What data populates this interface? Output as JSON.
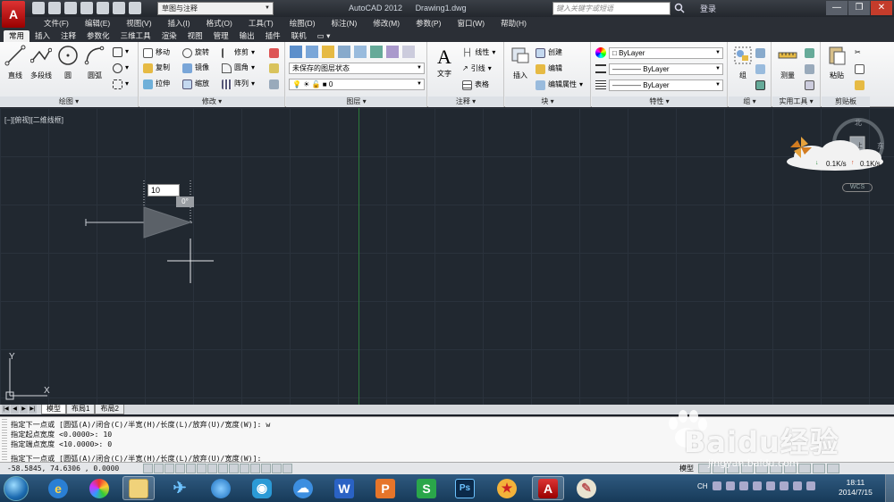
{
  "titlebar": {
    "logo": "A",
    "workspace": "草图与注释",
    "app_name": "AutoCAD 2012",
    "document": "Drawing1.dwg",
    "search_placeholder": "键入关键字或短语",
    "login": "登录",
    "minimize": "—",
    "restore": "❐",
    "close": "✕"
  },
  "menu": [
    "文件(F)",
    "编辑(E)",
    "视图(V)",
    "插入(I)",
    "格式(O)",
    "工具(T)",
    "绘图(D)",
    "标注(N)",
    "修改(M)",
    "参数(P)",
    "窗口(W)",
    "帮助(H)"
  ],
  "ribbon_tabs": [
    "常用",
    "插入",
    "注释",
    "参数化",
    "三维工具",
    "渲染",
    "视图",
    "管理",
    "输出",
    "插件",
    "联机"
  ],
  "panels": {
    "draw": {
      "title": "绘图 ▾",
      "line": "直线",
      "polyline": "多段线",
      "circle": "圆",
      "arc": "圆弧"
    },
    "modify": {
      "title": "修改 ▾",
      "move": "移动",
      "rotate": "旋转",
      "trim": "修剪",
      "copy": "复制",
      "mirror": "镜像",
      "fillet": "圆角",
      "stretch": "拉伸",
      "scale": "缩放",
      "array": "阵列"
    },
    "layers": {
      "title": "图层 ▾",
      "layer_state": "未保存的图层状态",
      "layer_value": "0"
    },
    "annotation": {
      "title": "注释 ▾",
      "text": "文字",
      "linear": "线性",
      "leader": "引线",
      "table": "表格"
    },
    "block": {
      "title": "块 ▾",
      "insert": "插入",
      "create": "创建",
      "edit": "编辑",
      "edit_attr": "编辑属性"
    },
    "properties": {
      "title": "特性 ▾",
      "color": "ByLayer",
      "linetype": "ByLayer",
      "lineweight": "ByLayer"
    },
    "groups": {
      "title": "组 ▾",
      "group": "组"
    },
    "utilities": {
      "title": "实用工具 ▾",
      "measure": "测量"
    },
    "clipboard": {
      "title": "剪贴板",
      "paste": "粘贴"
    }
  },
  "canvas": {
    "viewport_label": "[−][俯视][二维线框]",
    "dynamic_input_value": "10",
    "angle_tooltip": "0°",
    "viewcube": {
      "north": "北",
      "west": "西",
      "east": "东",
      "top": "上"
    },
    "wcs": "WCS",
    "ucs_x": "X",
    "ucs_y": "Y",
    "net_down": "0.1K/s",
    "net_up": "0.1K/s"
  },
  "layout_tabs": [
    "模型",
    "布局1",
    "布局2"
  ],
  "command_history": [
    "指定下一点或 [圆弧(A)/闭合(C)/半宽(H)/长度(L)/放弃(U)/宽度(W)]: w",
    "指定起点宽度 <0.0000>: 10",
    "指定端点宽度 <10.0000>: 0"
  ],
  "command_prompt": "指定下一点或 [圆弧(A)/闭合(C)/半宽(H)/长度(L)/放弃(U)/宽度(W)]:",
  "status": {
    "coordinates": "-58.5845,  74.6306 , 0.0000",
    "model_label": "模型"
  },
  "taskbar": {
    "apps": [
      "Internet Explorer",
      "Photo",
      "Explorer",
      "Bird",
      "Browser",
      "Player",
      "Cloud",
      "W",
      "P",
      "S",
      "Ps",
      "Game",
      "AutoCAD",
      "Paint"
    ],
    "lang": "CH",
    "time": "18:11",
    "date": "2014/7/15"
  },
  "watermark": {
    "brand": "Baidu经验",
    "url": "jingyan.baidu.com"
  },
  "colors": {
    "canvas": "#212830",
    "grid": "#2a323c",
    "axis_green": "#2c7a3a",
    "ribbon": "#ebedf0"
  }
}
